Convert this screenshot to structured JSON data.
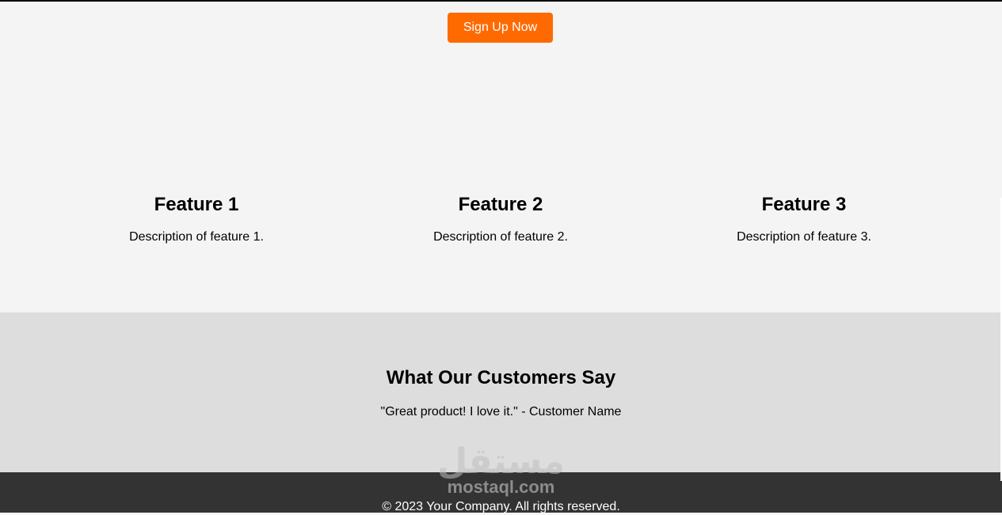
{
  "hero": {
    "cta_label": "Sign Up Now",
    "cta_color": "#ff6a00"
  },
  "features": [
    {
      "title": "Feature 1",
      "description": "Description of feature 1."
    },
    {
      "title": "Feature 2",
      "description": "Description of feature 2."
    },
    {
      "title": "Feature 3",
      "description": "Description of feature 3."
    }
  ],
  "testimonials": {
    "heading": "What Our Customers Say",
    "quote": "\"Great product! I love it.\" - Customer Name"
  },
  "footer": {
    "copyright": "© 2023 Your Company. All rights reserved."
  },
  "watermark": {
    "arabic": "مستقل",
    "latin": "mostaql.com"
  },
  "colors": {
    "page_background": "#f4f4f4",
    "testimonials_background": "#dddddd",
    "footer_background": "#333333"
  }
}
